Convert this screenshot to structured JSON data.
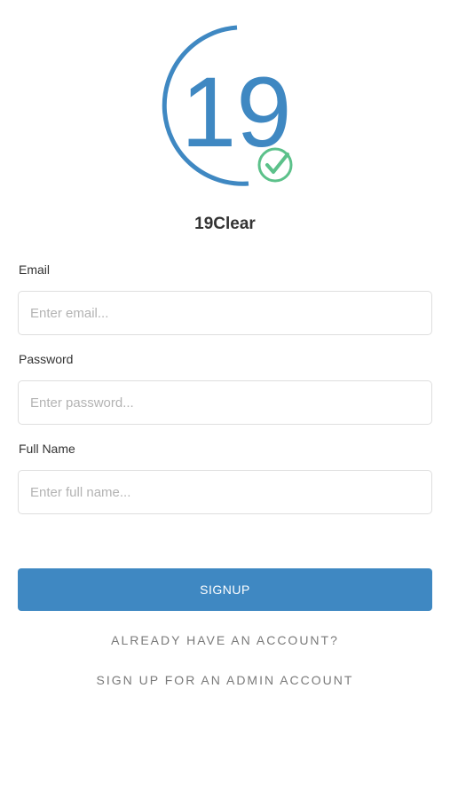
{
  "app": {
    "logo_number": "19",
    "title": "19Clear"
  },
  "colors": {
    "brand_blue": "#3f88c2",
    "check_green": "#5cc18a"
  },
  "icons": {
    "check": "check-circle-icon"
  },
  "form": {
    "email": {
      "label": "Email",
      "placeholder": "Enter email...",
      "value": ""
    },
    "password": {
      "label": "Password",
      "placeholder": "Enter password...",
      "value": ""
    },
    "full_name": {
      "label": "Full Name",
      "placeholder": "Enter full name...",
      "value": ""
    }
  },
  "actions": {
    "signup_label": "SIGNUP",
    "login_link": "ALREADY HAVE AN ACCOUNT?",
    "admin_link": "SIGN UP FOR AN ADMIN ACCOUNT"
  }
}
